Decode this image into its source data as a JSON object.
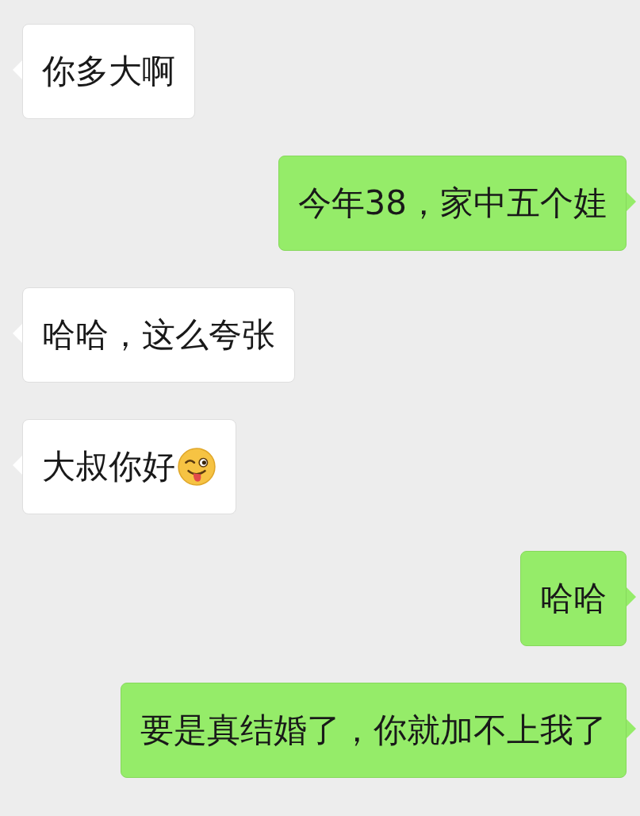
{
  "messages": [
    {
      "kind": "incoming",
      "text": "你多大啊"
    },
    {
      "kind": "outgoing",
      "text": "今年38，家中五个娃"
    },
    {
      "kind": "incoming",
      "text": "哈哈，这么夸张"
    },
    {
      "kind": "incoming",
      "text": "大叔你好",
      "emoji": true
    },
    {
      "kind": "outgoing",
      "text": "哈哈"
    },
    {
      "kind": "outgoing",
      "text": "要是真结婚了，你就加不上我了"
    }
  ]
}
